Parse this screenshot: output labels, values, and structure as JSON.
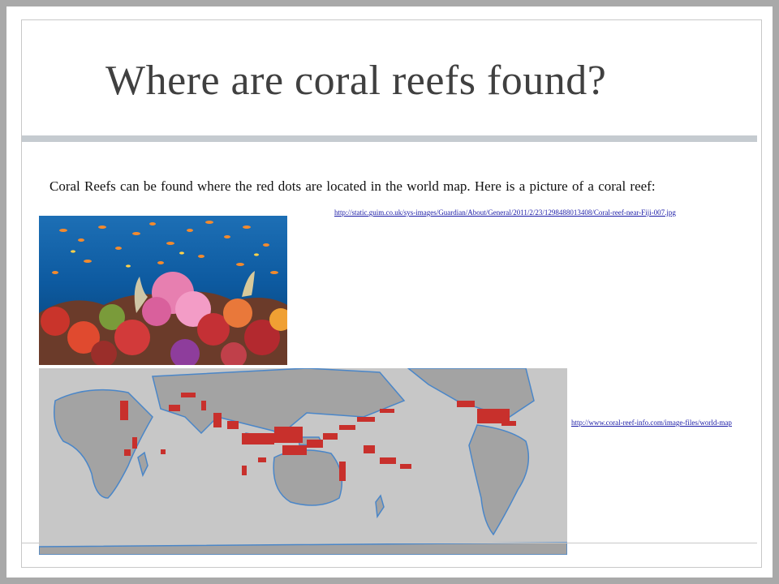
{
  "slide": {
    "title": "Where are coral reefs found?",
    "body": "Coral Reefs can be found where the red dots are located in the world map. Here is a picture of a coral reef:",
    "reef_image_link": "http://static.guim.co.uk/sys-images/Guardian/About/General/2011/2/23/1298488013408/Coral-reef-near-Fiji-007.jpg",
    "map_image_link": "http://www.coral-reef-info.com/image-files/world-map"
  },
  "colors": {
    "title": "#404040",
    "rule": "#c5cbd0",
    "link": "#1a1aa6",
    "reef_dots": "#c8302c",
    "ocean": "#c7c7c7",
    "land": "#a3a3a3",
    "coast": "#4a86c8"
  },
  "images": {
    "reef_photo": "coral-reef-photo",
    "world_map": "world-map-coral-reef-distribution"
  }
}
